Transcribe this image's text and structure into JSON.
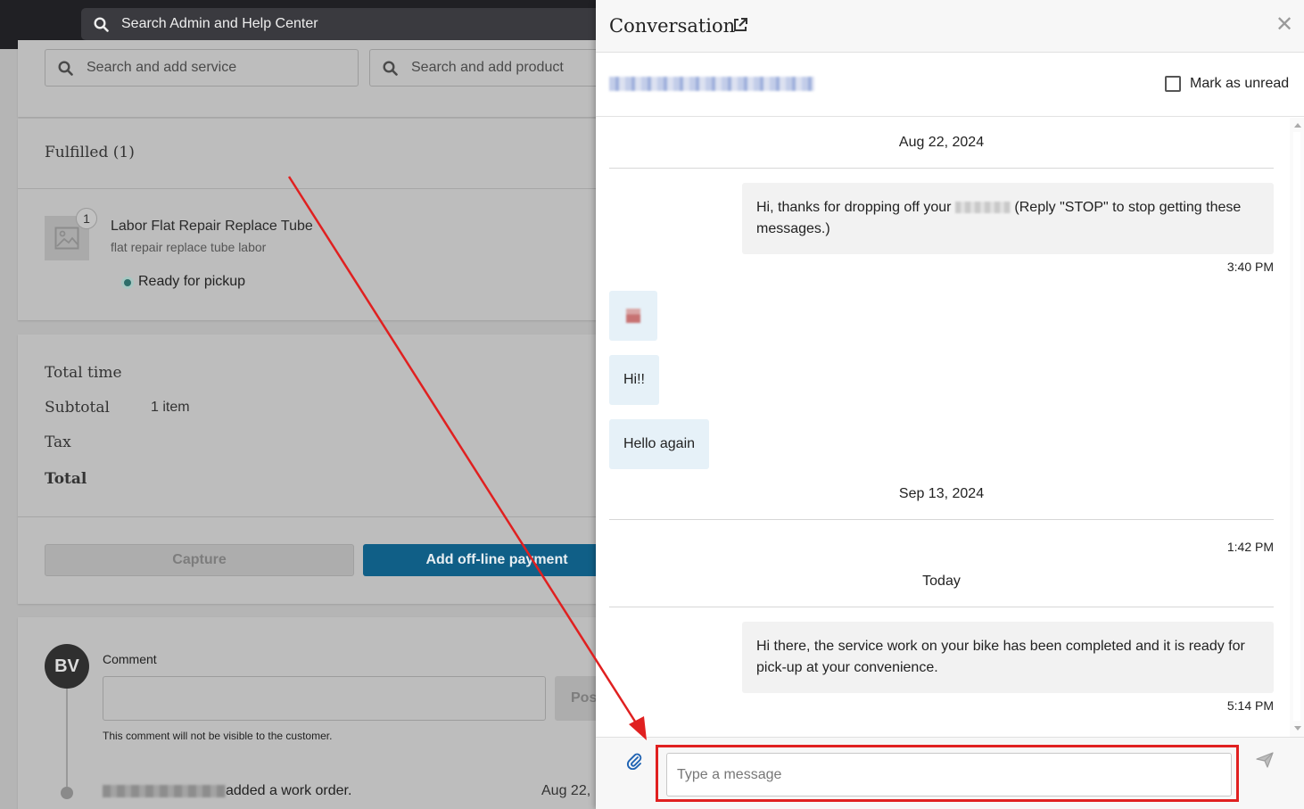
{
  "topbar": {
    "search_placeholder": "Search Admin and Help Center"
  },
  "work_order": {
    "search_service_placeholder": "Search and add service",
    "search_product_placeholder": "Search and add product",
    "fulfilled_title": "Fulfilled (1)",
    "item": {
      "quantity": "1",
      "title": "Labor Flat Repair Replace Tube",
      "subtitle": "flat repair replace tube labor",
      "status": "Ready for pickup"
    },
    "summary": {
      "total_time_label": "Total time",
      "subtotal_label": "Subtotal",
      "subtotal_value": "1 item",
      "tax_label": "Tax",
      "total_label": "Total"
    },
    "capture_label": "Capture",
    "offline_payment_label": "Add off-line payment",
    "comment": {
      "avatar_initials": "BV",
      "label": "Comment",
      "post_label": "Post",
      "note": "This comment will not be visible to the customer."
    },
    "activity": {
      "text": "added a work order.",
      "date": "Aug 22,"
    }
  },
  "conversation": {
    "title": "Conversation",
    "mark_unread_label": "Mark as unread",
    "messages": [
      {
        "date": "Aug 22, 2024"
      },
      {
        "outgoing_text_before": "Hi, thanks for dropping off your",
        "outgoing_text_after": "(Reply \"STOP\" to stop getting these messages.)",
        "time": "3:40 PM"
      },
      {
        "incoming_text": "Hi!!"
      },
      {
        "incoming_text": "Hello again"
      },
      {
        "date": "Sep 13, 2024"
      },
      {
        "time": "1:42 PM"
      },
      {
        "date": "Today"
      },
      {
        "outgoing_text": "Hi there, the service work on your bike has been completed and it is ready for pick-up at your convenience.",
        "time": "5:14 PM"
      }
    ],
    "composer": {
      "placeholder": "Type a message"
    }
  },
  "colors": {
    "annotation_red": "#e02020",
    "primary_button": "#105f87"
  },
  "icons": [
    "search-icon",
    "external-link-icon",
    "close-icon",
    "image-placeholder-icon",
    "paperclip-icon",
    "send-icon"
  ]
}
